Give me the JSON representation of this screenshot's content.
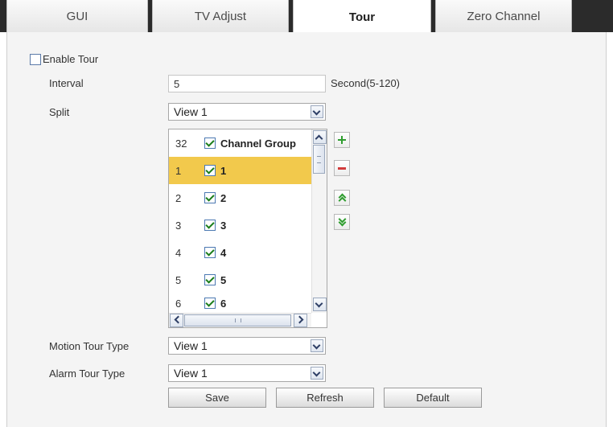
{
  "tabs": [
    {
      "label": "GUI",
      "active": false
    },
    {
      "label": "TV Adjust",
      "active": false
    },
    {
      "label": "Tour",
      "active": true
    },
    {
      "label": "Zero Channel",
      "active": false
    }
  ],
  "form": {
    "enable_tour_label": "Enable Tour",
    "enable_tour_checked": false,
    "interval_label": "Interval",
    "interval_value": "5",
    "interval_hint": "Second(5-120)",
    "split_label": "Split",
    "split_value": "View 1",
    "motion_tour_type_label": "Motion Tour Type",
    "motion_tour_type_value": "View 1",
    "alarm_tour_type_label": "Alarm Tour Type",
    "alarm_tour_type_value": "View 1"
  },
  "channel_list": {
    "header": {
      "number": "32",
      "label": "Channel Group",
      "checked": true
    },
    "rows": [
      {
        "number": "1",
        "label": "1",
        "checked": true,
        "selected": true
      },
      {
        "number": "2",
        "label": "2",
        "checked": true,
        "selected": false
      },
      {
        "number": "3",
        "label": "3",
        "checked": true,
        "selected": false
      },
      {
        "number": "4",
        "label": "4",
        "checked": true,
        "selected": false
      },
      {
        "number": "5",
        "label": "5",
        "checked": true,
        "selected": false
      },
      {
        "number": "6",
        "label": "6",
        "checked": true,
        "selected": false
      }
    ]
  },
  "side_buttons": [
    "plus-icon",
    "minus-icon",
    "double-up-icon",
    "double-down-icon"
  ],
  "buttons": {
    "save": "Save",
    "refresh": "Refresh",
    "default": "Default"
  },
  "colors": {
    "selected_row": "#f2c94c",
    "tab_bar": "#2b2b2b",
    "panel": "#f4f4f4"
  }
}
